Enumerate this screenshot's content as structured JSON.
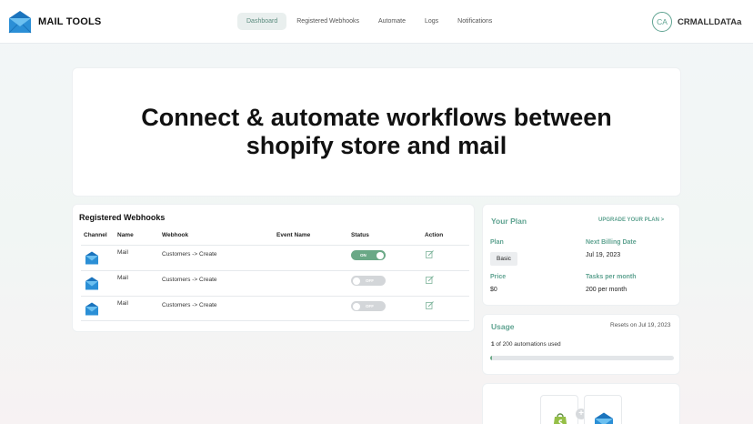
{
  "brand": {
    "name": "MAIL TOOLS"
  },
  "nav": {
    "items": [
      {
        "label": "Dashboard",
        "active": true
      },
      {
        "label": "Registered Webhooks",
        "active": false
      },
      {
        "label": "Automate",
        "active": false
      },
      {
        "label": "Logs",
        "active": false
      },
      {
        "label": "Notifications",
        "active": false
      }
    ]
  },
  "user": {
    "initials": "CA",
    "name": "CRMALLDATAa"
  },
  "hero": {
    "heading": "Connect & automate workflows between shopify store and mail"
  },
  "webhooks": {
    "title": "Registered Webhooks",
    "columns": [
      "Channel",
      "Name",
      "Webhook",
      "Event Name",
      "Status",
      "Action"
    ],
    "rows": [
      {
        "channel_icon": "mail-envelope-icon",
        "name": "Mail",
        "webhook": "Customers -> Create",
        "event_name": "",
        "status": "ON"
      },
      {
        "channel_icon": "mail-envelope-icon",
        "name": "Mail",
        "webhook": "Customers -> Create",
        "event_name": "",
        "status": "OFF"
      },
      {
        "channel_icon": "mail-envelope-icon",
        "name": "Mail",
        "webhook": "Customers -> Create",
        "event_name": "",
        "status": "OFF"
      }
    ],
    "action_icon": "edit-icon"
  },
  "plan": {
    "title": "Your Plan",
    "upgrade_label": "UPGRADE YOUR PLAN >",
    "plan_label": "Plan",
    "plan_value": "Basic",
    "billing_label": "Next Billing Date",
    "billing_value": "Jul 19, 2023",
    "price_label": "Price",
    "price_value": "$0",
    "tasks_label": "Tasks per month",
    "tasks_value": "200 per month"
  },
  "usage": {
    "title": "Usage",
    "resets": "Resets on Jul 19, 2023",
    "used_count": "1",
    "used_rest": " of 200 automations used",
    "fraction": 0.005
  },
  "integration": {
    "left_icon": "shopify-bag-icon",
    "right_icon": "mail-envelope-icon",
    "plus": "+"
  },
  "colors": {
    "accent": "#5fa391",
    "toggle_on": "#6aa886",
    "toggle_off": "#d3d6d9"
  }
}
